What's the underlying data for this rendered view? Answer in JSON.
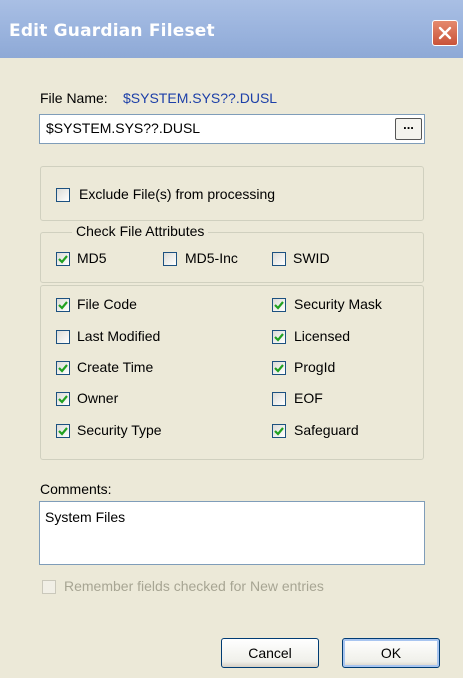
{
  "window": {
    "title": "Edit Guardian Fileset",
    "close_glyph": "close-icon"
  },
  "file": {
    "label": "File Name:",
    "display_value": "$SYSTEM.SYS??.DUSL",
    "input_value": "$SYSTEM.SYS??.DUSL",
    "browse_label": "..."
  },
  "exclude": {
    "label": "Exclude File(s) from processing",
    "checked": false
  },
  "attributes": {
    "legend": "Check File Attributes",
    "hash_options": [
      {
        "label": "MD5",
        "checked": true
      },
      {
        "label": "MD5-Inc",
        "checked": false
      },
      {
        "label": "SWID",
        "checked": false
      }
    ],
    "left_column": [
      {
        "label": "File Code",
        "checked": true
      },
      {
        "label": "Last Modified",
        "checked": false
      },
      {
        "label": "Create Time",
        "checked": true
      },
      {
        "label": "Owner",
        "checked": true
      },
      {
        "label": "Security Type",
        "checked": true
      }
    ],
    "right_column": [
      {
        "label": "Security Mask",
        "checked": true
      },
      {
        "label": "Licensed",
        "checked": true
      },
      {
        "label": "ProgId",
        "checked": true
      },
      {
        "label": "EOF",
        "checked": false
      },
      {
        "label": "Safeguard",
        "checked": true
      }
    ]
  },
  "comments": {
    "label": "Comments:",
    "value": "System Files"
  },
  "remember": {
    "label": "Remember fields checked for New entries",
    "checked": false,
    "enabled": false
  },
  "buttons": {
    "cancel": "Cancel",
    "ok": "OK"
  },
  "colors": {
    "title_bar": "#9bb4de",
    "dialog_bg": "#ece9d8",
    "check_green": "#21a121",
    "path_blue": "#1c3fa8",
    "close_red": "#d0583e"
  }
}
